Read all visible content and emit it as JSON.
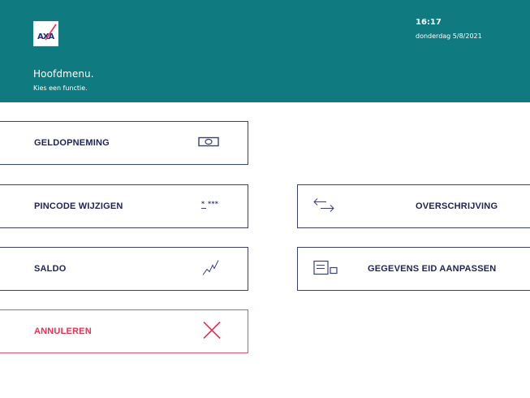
{
  "header": {
    "brand": "AXA",
    "title": "Hoofdmenu.",
    "subtitle": "Kies een functie.",
    "time": "16:17",
    "date": "donderdag 5/8/2021"
  },
  "menu": {
    "withdrawal_label": "GELDOPNEMING",
    "change_pin_label": "PINCODE WIJZIGEN",
    "balance_label": "SALDO",
    "cancel_label": "ANNULEREN",
    "transfer_label": "OVERSCHRIJVING",
    "update_eid_label": "GEGEVENS EID AANPASSEN"
  },
  "icons": {
    "withdrawal": "banknote-icon",
    "change_pin": "pin-dots-icon",
    "balance": "chart-line-icon",
    "cancel": "close-icon",
    "transfer": "swap-arrows-icon",
    "update_eid": "id-card-icon"
  },
  "colors": {
    "header_bg": "#0f7a80",
    "button_border": "#3b3f7a",
    "button_text": "#1f2354",
    "cancel": "#e8324f"
  }
}
